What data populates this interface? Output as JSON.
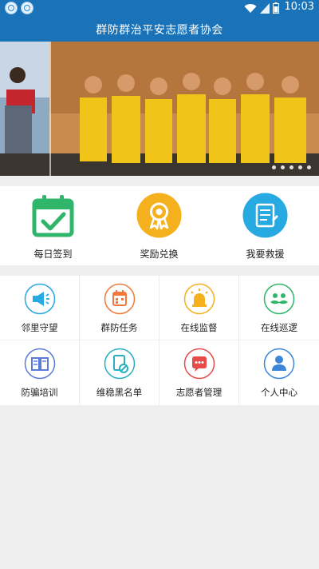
{
  "status": {
    "time": "10:03"
  },
  "app": {
    "title": "群防群治平安志愿者协会"
  },
  "banner": {
    "slide_count": 5
  },
  "top_actions": [
    {
      "label": "每日签到",
      "icon": "calendar-check-icon",
      "color": "#2fb66b"
    },
    {
      "label": "奖励兑换",
      "icon": "award-ribbon-icon",
      "color": "#f5b01e"
    },
    {
      "label": "我要救援",
      "icon": "document-rescue-icon",
      "color": "#27a9e1"
    }
  ],
  "grid": [
    {
      "label": "邻里守望",
      "icon": "megaphone-icon",
      "color": "#27a9e1"
    },
    {
      "label": "群防任务",
      "icon": "task-calendar-icon",
      "color": "#f07a3c"
    },
    {
      "label": "在线监督",
      "icon": "alarm-light-icon",
      "color": "#f5b01e"
    },
    {
      "label": "在线巡逻",
      "icon": "patrol-mustache-icon",
      "color": "#2fb66b"
    },
    {
      "label": "防骗培训",
      "icon": "book-icon",
      "color": "#5a7bd8"
    },
    {
      "label": "维稳黑名单",
      "icon": "blacklist-doc-icon",
      "color": "#27b0c2"
    },
    {
      "label": "志愿者管理",
      "icon": "chat-bubble-icon",
      "color": "#e94b4b"
    },
    {
      "label": "个人中心",
      "icon": "person-icon",
      "color": "#3c86d8"
    }
  ]
}
